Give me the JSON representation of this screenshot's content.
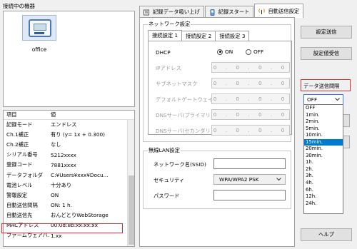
{
  "connected_panel": {
    "title": "接続中の機器",
    "device_name": "office"
  },
  "info_table": {
    "headers": [
      "項目",
      "値"
    ],
    "rows": [
      {
        "key": "記録モード",
        "value": "エンドレス"
      },
      {
        "key": "Ch.1補正",
        "value": "有り (y=  1x + 0.300)"
      },
      {
        "key": "Ch.2補正",
        "value": "なし"
      },
      {
        "key": "シリアル番号",
        "value": "5212xxxx"
      },
      {
        "key": "登録コード",
        "value": "7881xxxx"
      },
      {
        "key": "データフォルダ",
        "value": "C:¥Users¥xxx¥Docu..."
      },
      {
        "key": "電池レベル",
        "value": "十分あり"
      },
      {
        "key": "警報設定",
        "value": "ON"
      },
      {
        "key": "自動送信間隔",
        "value": "ON: 1 h."
      },
      {
        "key": "自動送信先",
        "value": "おんどとりWebStorage"
      },
      {
        "key": "MACアドレス",
        "value": "00:0d:8b:xx:xx:xx"
      },
      {
        "key": "ファームウェアバ...",
        "value": "1.xx"
      }
    ]
  },
  "tabs": [
    {
      "label": "記録データ吸い上げ"
    },
    {
      "label": "記録スタート"
    },
    {
      "label": "自動送信設定"
    }
  ],
  "network": {
    "group_label": "ネットワーク設定",
    "subtabs": [
      "接続設定 1",
      "接続設定 2",
      "接続設定 3"
    ],
    "dhcp_label": "DHCP",
    "dhcp_on": "ON",
    "dhcp_off": "OFF",
    "fields": [
      {
        "label": "IPアドレス",
        "value": "0 . 0 . 0 . 0"
      },
      {
        "label": "サブネットマスク",
        "value": "0 . 0 . 0 . 0"
      },
      {
        "label": "デフォルトゲートウェイ",
        "value": "0 . 0 . 0 . 0"
      },
      {
        "label": "DNSサーバ(プライマリ)",
        "value": "0 . 0 . 0 . 0"
      },
      {
        "label": "DNSサーバ(セカンダリ)",
        "value": "0 . 0 . 0 . 0"
      }
    ]
  },
  "wireless": {
    "group_label": "無線LAN設定",
    "ssid_label": "ネットワーク名(SSID)",
    "ssid_value": "",
    "security_label": "セキュリティ",
    "security_value": "WPA/WPA2 PSK",
    "password_label": "パスワード",
    "password_value": ""
  },
  "buttons": {
    "send_settings": "設定送信",
    "receive_settings": "設定値受信",
    "help": "ヘルプ"
  },
  "interval": {
    "label": "データ送信間隔",
    "selected": "OFF",
    "options": [
      "OFF",
      "1min.",
      "2min.",
      "5min.",
      "10min.",
      "15min.",
      "20min.",
      "30min.",
      "1h.",
      "2h.",
      "3h.",
      "4h.",
      "6h.",
      "12h.",
      "24h."
    ],
    "highlighted": "15min."
  },
  "colors": {
    "highlight_border": "#e02d35",
    "selection_blue": "#0078d7"
  }
}
